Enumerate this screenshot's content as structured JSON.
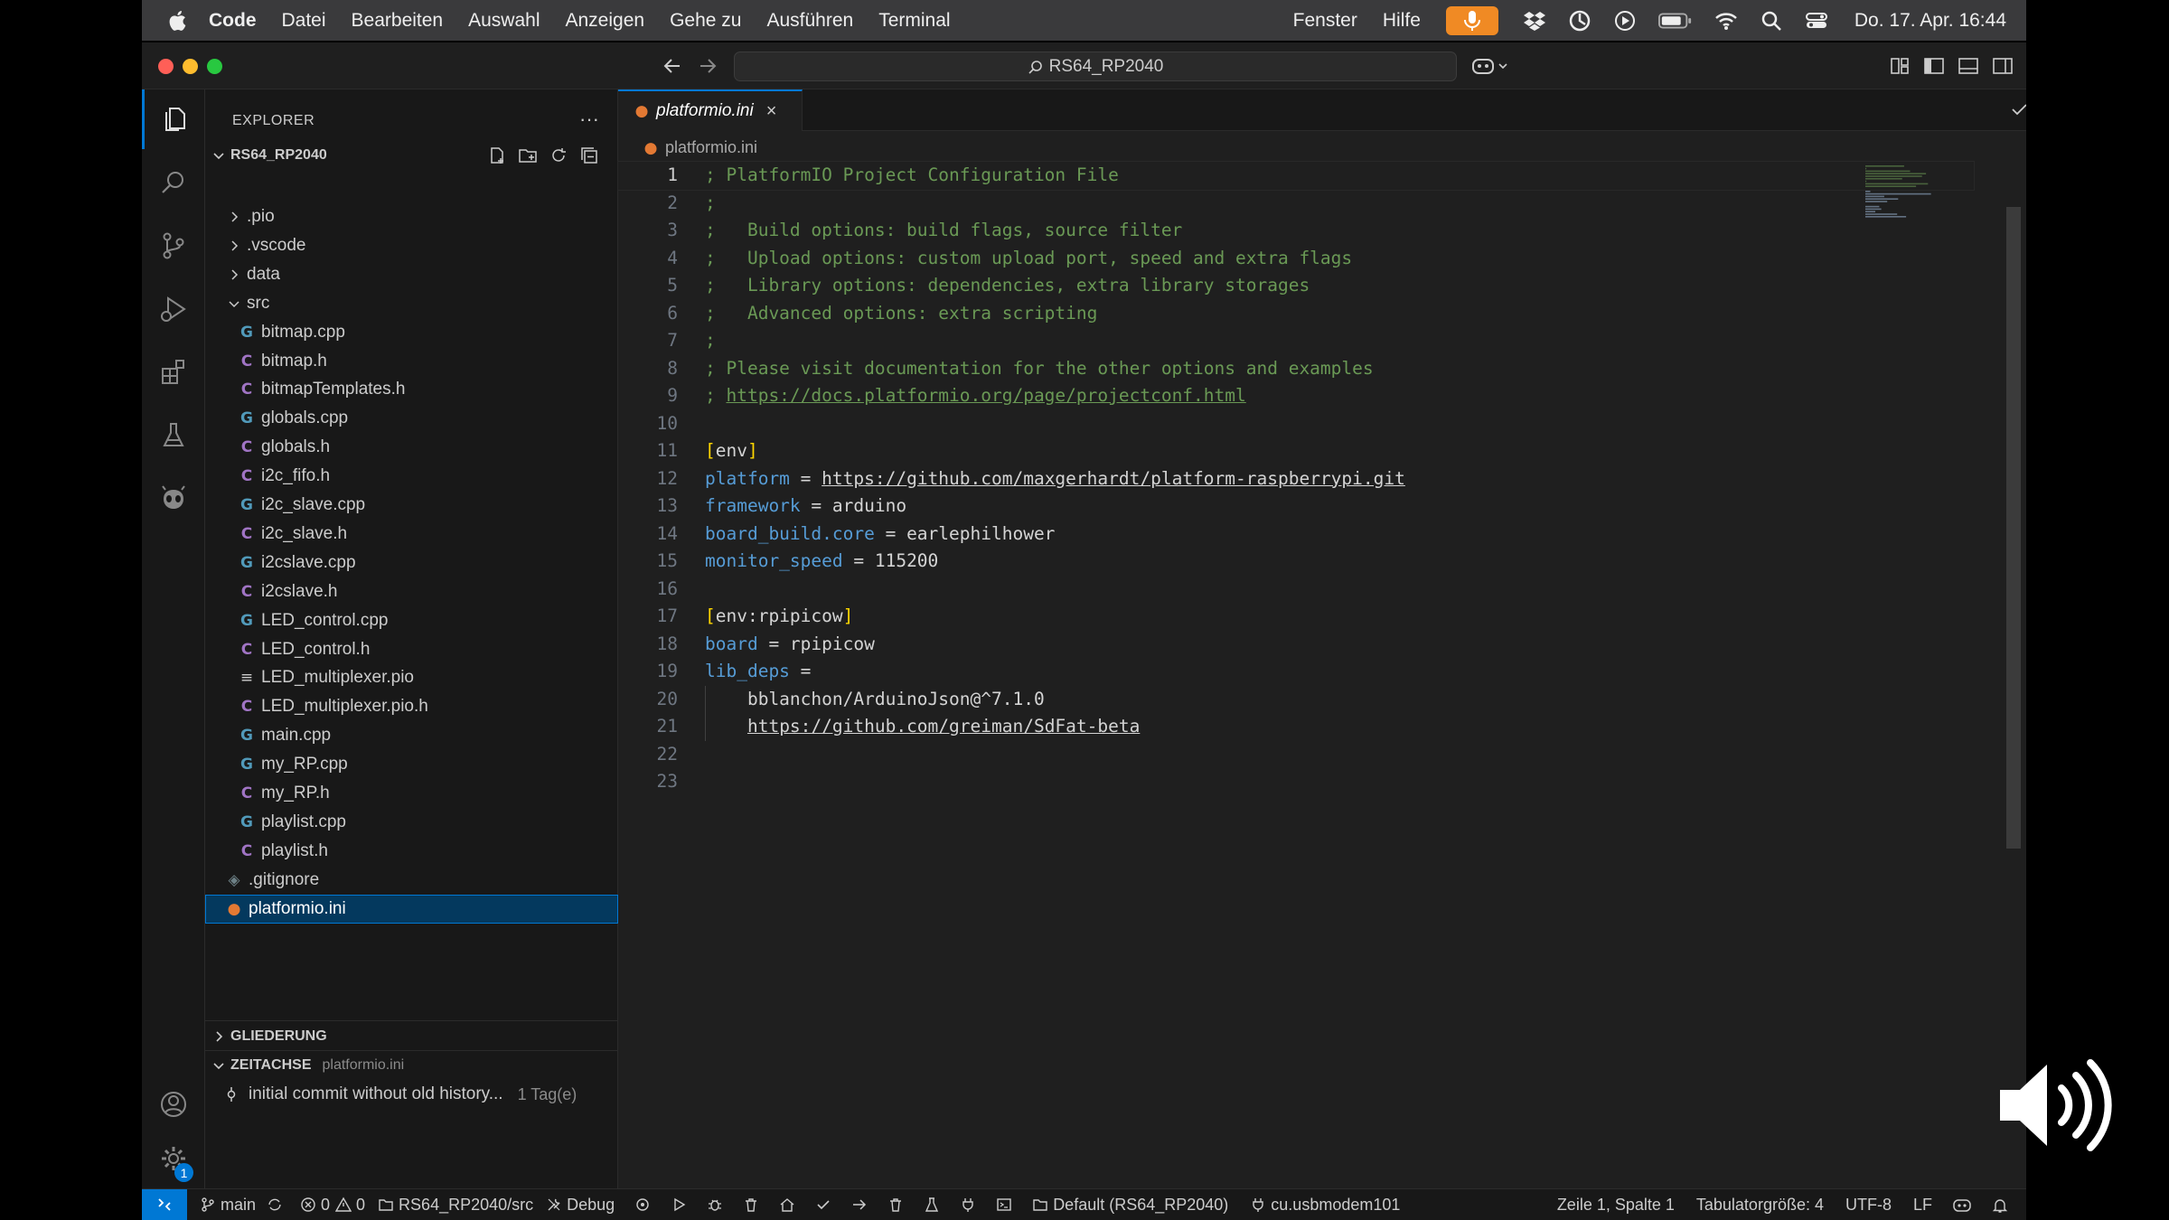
{
  "menubar": {
    "app_name": "Code",
    "items": [
      "Datei",
      "Bearbeiten",
      "Auswahl",
      "Anzeigen",
      "Gehe zu",
      "Ausführen",
      "Terminal"
    ],
    "right_items": [
      "Fenster",
      "Hilfe"
    ],
    "clock": "Do. 17. Apr. 16:44",
    "accent": "#f08a24"
  },
  "titlebar": {
    "command_center": "RS64_RP2040"
  },
  "sidebar": {
    "title": "EXPLORER",
    "folder_name": "RS64_RP2040",
    "tree": [
      {
        "label": ".pio",
        "type": "folder",
        "depth": 1,
        "expanded": false
      },
      {
        "label": ".vscode",
        "type": "folder",
        "depth": 1,
        "expanded": false
      },
      {
        "label": "data",
        "type": "folder",
        "depth": 1,
        "expanded": false
      },
      {
        "label": "src",
        "type": "folder",
        "depth": 1,
        "expanded": true
      },
      {
        "label": "bitmap.cpp",
        "type": "cpp",
        "depth": 2
      },
      {
        "label": "bitmap.h",
        "type": "h",
        "depth": 2
      },
      {
        "label": "bitmapTemplates.h",
        "type": "h",
        "depth": 2
      },
      {
        "label": "globals.cpp",
        "type": "cpp",
        "depth": 2
      },
      {
        "label": "globals.h",
        "type": "h",
        "depth": 2
      },
      {
        "label": "i2c_fifo.h",
        "type": "h",
        "depth": 2
      },
      {
        "label": "i2c_slave.cpp",
        "type": "cpp",
        "depth": 2
      },
      {
        "label": "i2c_slave.h",
        "type": "h",
        "depth": 2
      },
      {
        "label": "i2cslave.cpp",
        "type": "cpp",
        "depth": 2
      },
      {
        "label": "i2cslave.h",
        "type": "h",
        "depth": 2
      },
      {
        "label": "LED_control.cpp",
        "type": "cpp",
        "depth": 2
      },
      {
        "label": "LED_control.h",
        "type": "h",
        "depth": 2
      },
      {
        "label": "LED_multiplexer.pio",
        "type": "pio",
        "depth": 2
      },
      {
        "label": "LED_multiplexer.pio.h",
        "type": "h",
        "depth": 2
      },
      {
        "label": "main.cpp",
        "type": "cpp",
        "depth": 2
      },
      {
        "label": "my_RP.cpp",
        "type": "cpp",
        "depth": 2
      },
      {
        "label": "my_RP.h",
        "type": "h",
        "depth": 2
      },
      {
        "label": "playlist.cpp",
        "type": "cpp",
        "depth": 2
      },
      {
        "label": "playlist.h",
        "type": "h",
        "depth": 2
      },
      {
        "label": ".gitignore",
        "type": "git",
        "depth": 1
      },
      {
        "label": "platformio.ini",
        "type": "ini",
        "depth": 1,
        "selected": true
      }
    ],
    "outline_title": "GLIEDERUNG",
    "timeline_title": "ZEITACHSE",
    "timeline_file": "platformio.ini",
    "timeline_entry": "initial commit without old history...",
    "timeline_age": "1 Tag(e)"
  },
  "editor": {
    "tab_label": "platformio.ini",
    "tab_close": "×",
    "breadcrumb": "platformio.ini",
    "lines": [
      [
        {
          "t": "; PlatformIO Project Configuration File",
          "c": "comment"
        }
      ],
      [
        {
          "t": ";",
          "c": "comment"
        }
      ],
      [
        {
          "t": ";   Build options: build flags, source filter",
          "c": "comment"
        }
      ],
      [
        {
          "t": ";   Upload options: custom upload port, speed and extra flags",
          "c": "comment"
        }
      ],
      [
        {
          "t": ";   Library options: dependencies, extra library storages",
          "c": "comment"
        }
      ],
      [
        {
          "t": ";   Advanced options: extra scripting",
          "c": "comment"
        }
      ],
      [
        {
          "t": ";",
          "c": "comment"
        }
      ],
      [
        {
          "t": "; Please visit documentation for the other options and examples",
          "c": "comment"
        }
      ],
      [
        {
          "t": "; ",
          "c": "comment"
        },
        {
          "t": "https://docs.platformio.org/page/projectconf.html",
          "c": "comment link"
        }
      ],
      [],
      [
        {
          "t": "[",
          "c": "sbrack"
        },
        {
          "t": "env",
          "c": "plain"
        },
        {
          "t": "]",
          "c": "sbrack"
        }
      ],
      [
        {
          "t": "platform",
          "c": "key"
        },
        {
          "t": " = ",
          "c": "plain"
        },
        {
          "t": "https://github.com/maxgerhardt/platform-raspberrypi.git",
          "c": "val link"
        }
      ],
      [
        {
          "t": "framework",
          "c": "key"
        },
        {
          "t": " = arduino",
          "c": "plain"
        }
      ],
      [
        {
          "t": "board_build.core",
          "c": "key"
        },
        {
          "t": " = earlephilhower",
          "c": "plain"
        }
      ],
      [
        {
          "t": "monitor_speed",
          "c": "key"
        },
        {
          "t": " = 115200",
          "c": "plain"
        }
      ],
      [],
      [
        {
          "t": "[",
          "c": "sbrack"
        },
        {
          "t": "env:rpipicow",
          "c": "plain"
        },
        {
          "t": "]",
          "c": "sbrack"
        }
      ],
      [
        {
          "t": "board",
          "c": "key"
        },
        {
          "t": " = rpipicow",
          "c": "plain"
        }
      ],
      [
        {
          "t": "lib_deps",
          "c": "key"
        },
        {
          "t": " =",
          "c": "plain"
        }
      ],
      [
        {
          "t": "    bblanchon/ArduinoJson@^7.1.0",
          "c": "plain"
        }
      ],
      [
        {
          "t": "    ",
          "c": "plain"
        },
        {
          "t": "https://github.com/greiman/SdFat-beta",
          "c": "val link"
        }
      ],
      [],
      []
    ],
    "current_line": 1
  },
  "statusbar": {
    "branch": "main",
    "errors": "0",
    "warnings": "0",
    "project_env": "RS64_RP2040/src",
    "debug": "Debug",
    "env_default": "Default (RS64_RP2040)",
    "port": "cu.usbmodem101",
    "cursor_pos": "Zeile 1, Spalte 1",
    "tab_size": "Tabulatorgröße: 4",
    "encoding": "UTF-8",
    "eol": "LF"
  },
  "activity": {
    "settings_badge": "1"
  }
}
